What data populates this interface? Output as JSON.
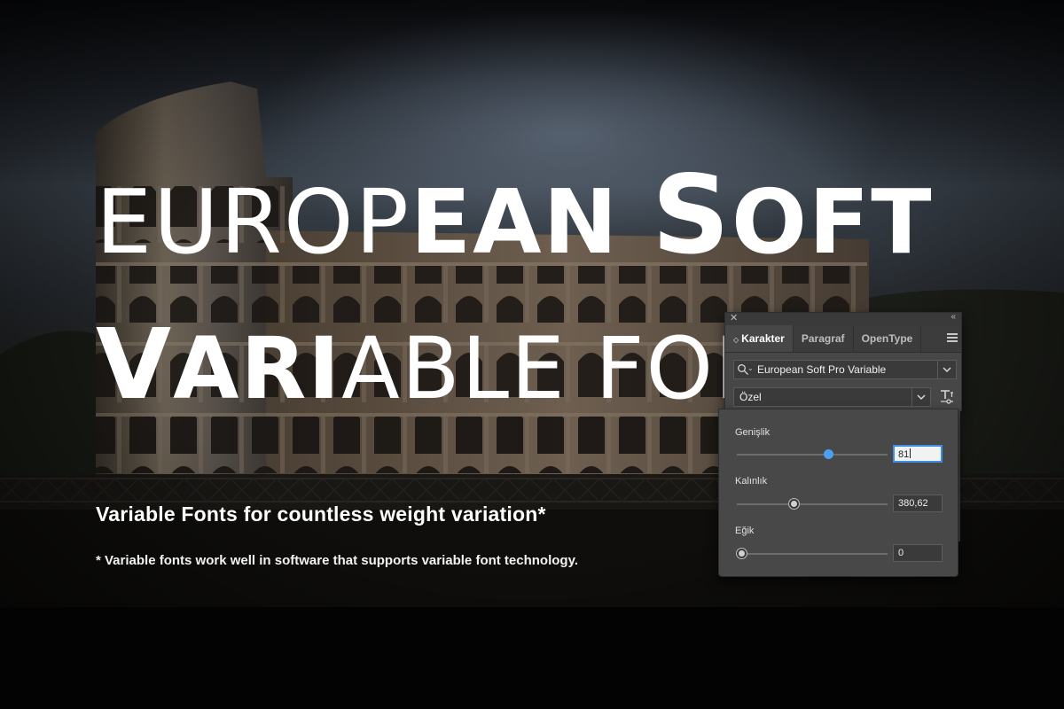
{
  "headline": {
    "line1_thin": "EUROP",
    "line1_bold_a": "EAN ",
    "line1_bold_big": "S",
    "line1_bold_b": "OFT",
    "line2_bold_big": "V",
    "line2_bold": "ARI",
    "line2_thin": "ABLE FONT"
  },
  "tagline": "Variable Fonts for countless weight variation*",
  "footnote": "* Variable fonts work well in software that supports variable font technology.",
  "panel": {
    "tabs": [
      {
        "label": "Karakter",
        "active": true
      },
      {
        "label": "Paragraf",
        "active": false
      },
      {
        "label": "OpenType",
        "active": false
      }
    ],
    "font_family": "European Soft Pro Variable",
    "font_style": "Özel",
    "axes": [
      {
        "label": "Genişlik",
        "value": "81",
        "slider_fraction": 0.61,
        "focused": true
      },
      {
        "label": "Kalınlık",
        "value": "380,62",
        "slider_fraction": 0.38,
        "focused": false
      },
      {
        "label": "Eğik",
        "value": "0",
        "slider_fraction": 0.0,
        "focused": false
      }
    ],
    "icons": [
      "close-icon",
      "collapse-icon",
      "panel-menu-icon",
      "search-icon",
      "chevron-down-icon",
      "variable-font-icon"
    ],
    "accent_color": "#4aa0f5"
  }
}
